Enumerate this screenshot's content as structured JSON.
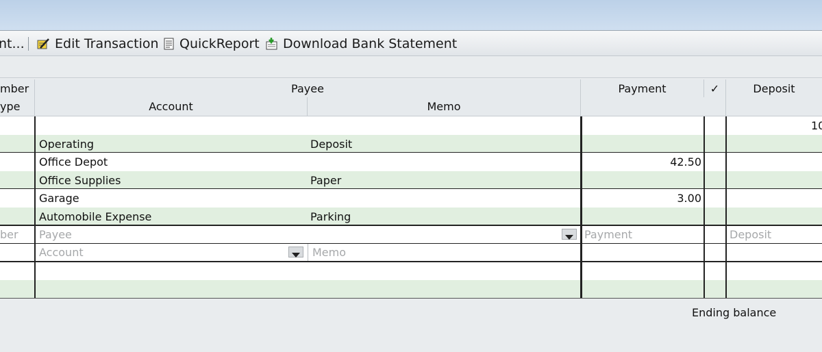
{
  "toolbar": {
    "items": [
      {
        "label": "nt...",
        "icon": "truncated-item"
      },
      {
        "label": "Edit Transaction",
        "icon": "edit-icon"
      },
      {
        "label": "QuickReport",
        "icon": "report-icon"
      },
      {
        "label": "Download Bank Statement",
        "icon": "download-icon"
      }
    ]
  },
  "headers": {
    "row1": {
      "number": "mber",
      "payee": "Payee",
      "payment": "Payment",
      "check": "✓",
      "deposit": "Deposit"
    },
    "row2": {
      "type": "ype",
      "account": "Account",
      "memo": "Memo"
    }
  },
  "transactions": [
    {
      "payee": "",
      "account": "Operating",
      "memo": "Deposit",
      "payment": "",
      "deposit": "10"
    },
    {
      "payee": "Office Depot",
      "account": "Office Supplies",
      "memo": "Paper",
      "payment": "42.50",
      "deposit": ""
    },
    {
      "payee": "Garage",
      "account": "Automobile Expense",
      "memo": "Parking",
      "payment": "3.00",
      "deposit": ""
    }
  ],
  "new_entry": {
    "number_placeholder": "ber",
    "payee_placeholder": "Payee",
    "account_placeholder": "Account",
    "memo_placeholder": "Memo",
    "payment_placeholder": "Payment",
    "deposit_placeholder": "Deposit"
  },
  "footer": {
    "ending_balance_label": "Ending balance"
  },
  "colors": {
    "row_alt": "#e1efe0",
    "title_bar": "#bcd1e8"
  }
}
